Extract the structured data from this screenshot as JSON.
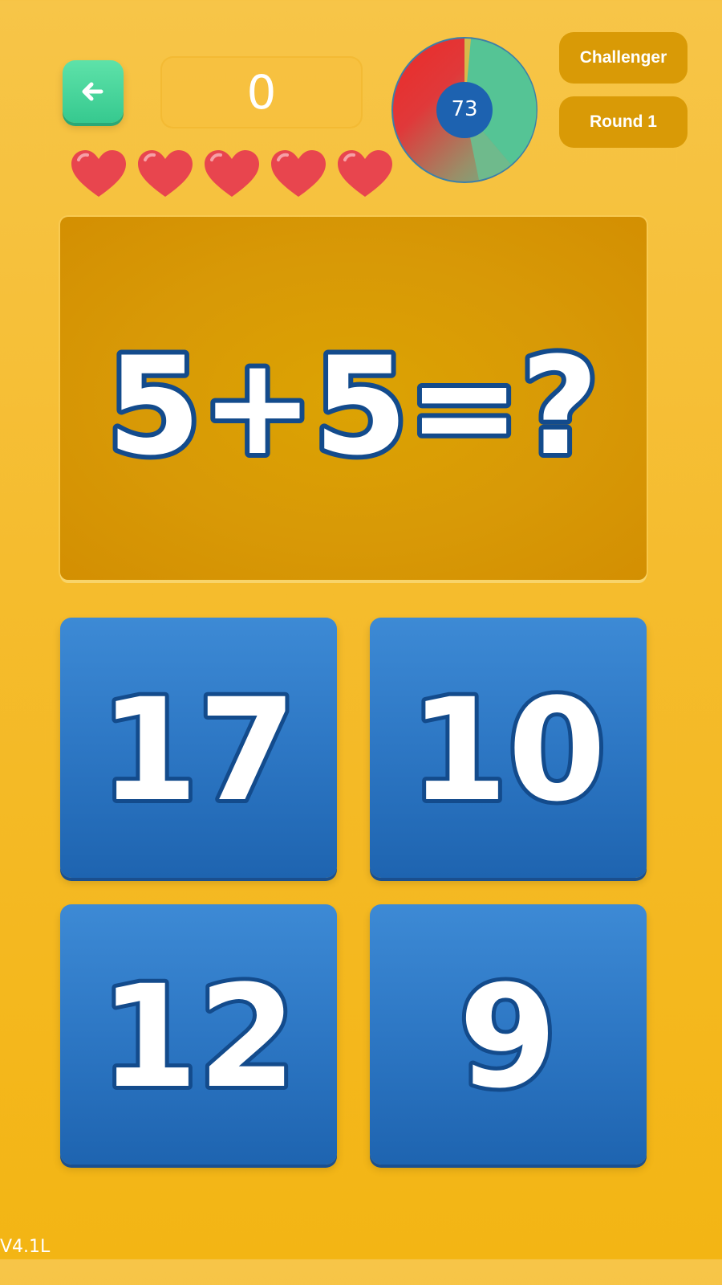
{
  "header": {
    "back_icon": "arrow-left-icon",
    "score": "0",
    "lives": 5,
    "life_icon": "heart-icon",
    "timer": {
      "value": "73",
      "colors": {
        "remaining": "#55c495",
        "warning": "#e52f2a",
        "center": "#1d62b0"
      }
    },
    "mode_label": "Challenger",
    "round_label": "Round 1"
  },
  "question": {
    "text": "5+5=?"
  },
  "answers": [
    "17",
    "10",
    "12",
    "9"
  ],
  "footer": {
    "version": "V4.1L"
  },
  "colors": {
    "background": "#f5bc2e",
    "card": "#d89906",
    "answer_tile": "#2d77c4",
    "text_outline": "#134b8c",
    "back_button": "#3fd198"
  }
}
